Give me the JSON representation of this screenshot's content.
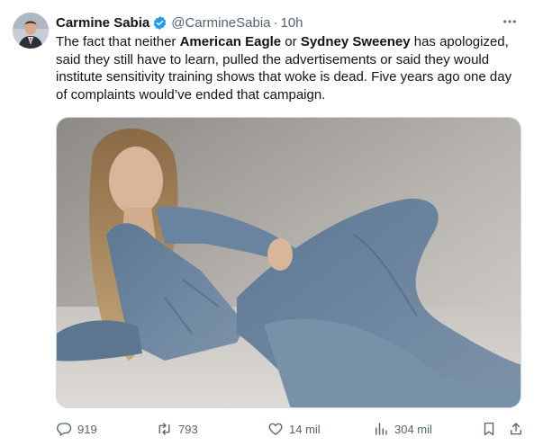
{
  "author": {
    "name": "Carmine Sabia",
    "handle": "@CarmineSabia",
    "time": "10h",
    "verified": true,
    "avatar_icon": "profile-photo"
  },
  "tweet": {
    "segments": [
      {
        "text": "The fact that neither ",
        "bold": false
      },
      {
        "text": "American Eagle",
        "bold": true
      },
      {
        "text": " or ",
        "bold": false
      },
      {
        "text": "Sydney Sweeney",
        "bold": true
      },
      {
        "text": " has apologized, said they still have to learn, pulled the advertisements or said they would institute sensitivity training shows that woke is dead. Five years ago one day of complaints would’ve ended that campaign.",
        "bold": false
      }
    ]
  },
  "actions": {
    "replies": "919",
    "reposts": "793",
    "likes": "14 mil",
    "views": "304 mil"
  },
  "colors": {
    "text": "#0f1419",
    "muted": "#536471",
    "verified": "#1d9bf0",
    "border": "#cfd9de"
  }
}
